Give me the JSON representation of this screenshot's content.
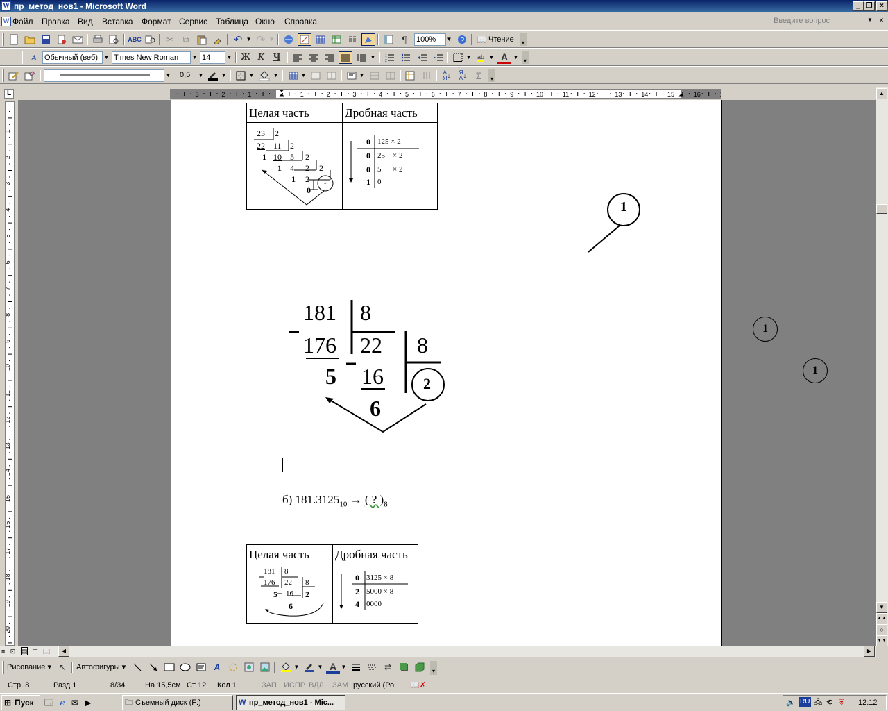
{
  "window": {
    "title": "пр_метод_нов1 - Microsoft Word",
    "app_icon": "word-icon"
  },
  "menu": {
    "items": [
      "Файл",
      "Правка",
      "Вид",
      "Вставка",
      "Формат",
      "Сервис",
      "Таблица",
      "Окно",
      "Справка"
    ],
    "help_placeholder": "Введите вопрос"
  },
  "toolbar": {
    "zoom": "100%",
    "reading_label": "Чтение",
    "style": "Обычный (веб)",
    "font": "Times New Roman",
    "font_size": "14",
    "bold": "Ж",
    "italic": "К",
    "underline": "Ч",
    "line_weight": "0,5"
  },
  "ruler": {
    "top_ticks": [
      "3",
      "2",
      "1",
      "1",
      "2",
      "3",
      "4",
      "5",
      "6",
      "7",
      "8",
      "9",
      "10",
      "11",
      "12",
      "13",
      "14",
      "15",
      "16",
      "17"
    ],
    "left_ticks": [
      "1",
      "2",
      "3",
      "4",
      "5",
      "6",
      "7",
      "8",
      "9",
      "10",
      "11",
      "12",
      "13",
      "14",
      "15",
      "16",
      "17",
      "18",
      "19",
      "20"
    ]
  },
  "document": {
    "table1": {
      "headers": [
        "Целая часть",
        "Дробная часть"
      ],
      "int_digits": [
        "23",
        "2",
        "22",
        "11",
        "2",
        "1",
        "10",
        "5",
        "2",
        "1",
        "4",
        "2",
        "2",
        "1",
        "2",
        "0",
        "1"
      ],
      "frac_rows": [
        {
          "digit": "0",
          "value": "125 × 2"
        },
        {
          "digit": "0",
          "value": "25",
          "mult": "× 2"
        },
        {
          "digit": "0",
          "value": "5",
          "mult": "× 2"
        },
        {
          "digit": "1",
          "value": "0"
        }
      ]
    },
    "circle_large": "1",
    "circle_small_a": "1",
    "circle_small_b": "1",
    "division": {
      "dividend": "181",
      "divisor": "8",
      "product1": "176",
      "quotient1": "22",
      "divisor2": "8",
      "remainder1": "5",
      "product2": "16",
      "remainder2": "6",
      "final_quotient": "2"
    },
    "task_b": {
      "prefix": "б) 181.3125",
      "sub_from": "10",
      "arrow": "→",
      "target": "( ? )",
      "sub_to": "8"
    },
    "table2": {
      "headers": [
        "Целая часть",
        "Дробная часть"
      ],
      "int_digits": [
        "181",
        "8",
        "176",
        "22",
        "8",
        "5",
        "16",
        "2",
        "6"
      ],
      "frac_rows": [
        {
          "digit": "0",
          "value": "3125 × 8"
        },
        {
          "digit": "2",
          "value": "5000 × 8"
        },
        {
          "digit": "4",
          "value": "0000"
        }
      ]
    }
  },
  "drawing": {
    "draw_label": "Рисование",
    "autoshapes_label": "Автофигуры"
  },
  "status": {
    "page": "Стр. 8",
    "section": "Разд 1",
    "pages": "8/34",
    "at": "На 15,5см",
    "line": "Ст 12",
    "col": "Кол 1",
    "rec": "ЗАП",
    "trk": "ИСПР",
    "ext": "ВДЛ",
    "ovr": "ЗАМ",
    "language": "русский (Ро"
  },
  "taskbar": {
    "start": "Пуск",
    "tasks": [
      "Съемный диск (F:)",
      "пр_метод_нов1 - Mic..."
    ],
    "lang": "RU",
    "clock": "12:12"
  }
}
